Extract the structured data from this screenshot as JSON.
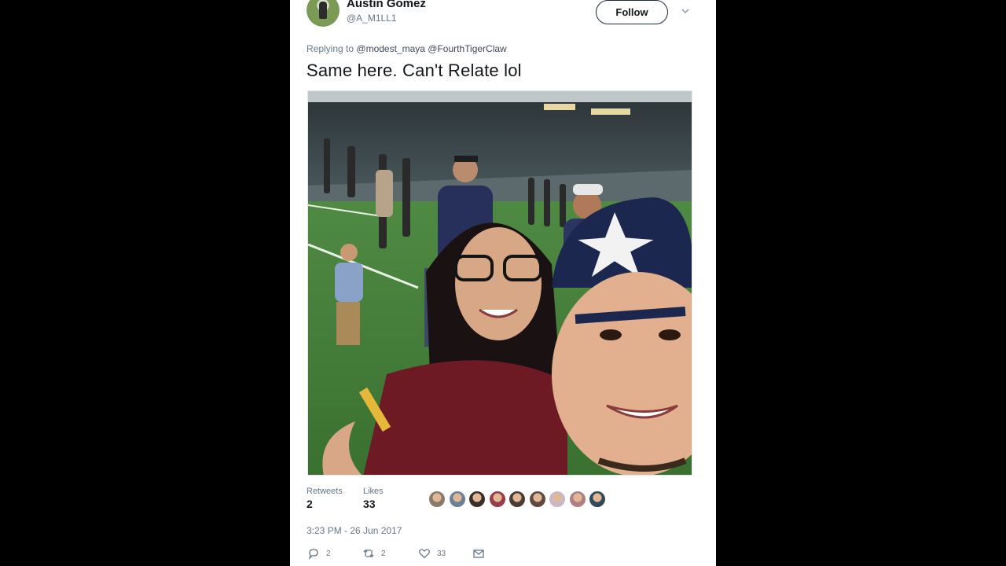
{
  "tweet": {
    "author_name": "Austin Gomez",
    "author_handle": "@A_M1LL1",
    "follow_label": "Follow",
    "replying_prefix": "Replying to",
    "replying_to": "@modest_maya @FourthTigerClaw",
    "text": "Same here. Can't Relate lol",
    "timestamp": "3:23 PM - 26 Jun 2017"
  },
  "stats": {
    "retweets_label": "Retweets",
    "retweets_value": "2",
    "likes_label": "Likes",
    "likes_value": "33"
  },
  "likers": [
    {
      "icon": "liker-avatar",
      "color": "#8a7a6a"
    },
    {
      "icon": "liker-avatar",
      "color": "#6c7f99"
    },
    {
      "icon": "liker-avatar",
      "color": "#3a2f2a"
    },
    {
      "icon": "liker-avatar",
      "color": "#9a3c4a"
    },
    {
      "icon": "liker-avatar",
      "color": "#4a3b33"
    },
    {
      "icon": "liker-avatar",
      "color": "#5e4a3f"
    },
    {
      "icon": "liker-avatar",
      "color": "#c9b9c7"
    },
    {
      "icon": "liker-avatar",
      "color": "#b07f86"
    },
    {
      "icon": "liker-avatar",
      "color": "#2f4a5a"
    }
  ],
  "actions": {
    "reply_icon": "reply-icon",
    "reply_count": "2",
    "retweet_icon": "retweet-icon",
    "retweet_count": "2",
    "like_icon": "heart-icon",
    "like_count": "33",
    "dm_icon": "envelope-icon"
  },
  "colors": {
    "background": "#000000",
    "card": "#ffffff",
    "text_primary": "#14171a",
    "text_secondary": "#657786"
  }
}
